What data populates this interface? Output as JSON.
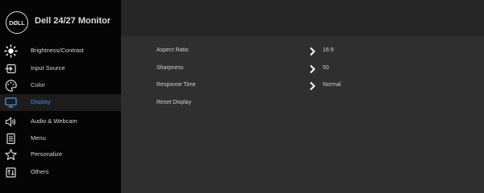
{
  "header": {
    "logo_text": "DØLL",
    "title": "Dell 24/27 Monitor"
  },
  "menu": [
    {
      "label": "Brightness/Contrast",
      "icon": "brightness-icon"
    },
    {
      "label": "Input Source",
      "icon": "input-source-icon"
    },
    {
      "label": "Color",
      "icon": "color-palette-icon"
    },
    {
      "label": "Display",
      "icon": "display-icon",
      "selected": true
    },
    {
      "label": "Audio & Webcam",
      "icon": "speaker-icon"
    },
    {
      "label": "Menu",
      "icon": "menu-icon"
    },
    {
      "label": "Personalize",
      "icon": "star-icon"
    },
    {
      "label": "Others",
      "icon": "others-icon"
    }
  ],
  "settings": [
    {
      "label": "Aspect Ratio",
      "value": "16:9"
    },
    {
      "label": "Sharpness",
      "value": "50"
    },
    {
      "label": "Response Time",
      "value": "Normal"
    },
    {
      "label": "Reset Display",
      "value": ""
    }
  ],
  "colors": {
    "accent": "#4b8ed3",
    "sidebar": "#050505",
    "panel": "#2f2f2f",
    "text": "#d4d4d4"
  }
}
